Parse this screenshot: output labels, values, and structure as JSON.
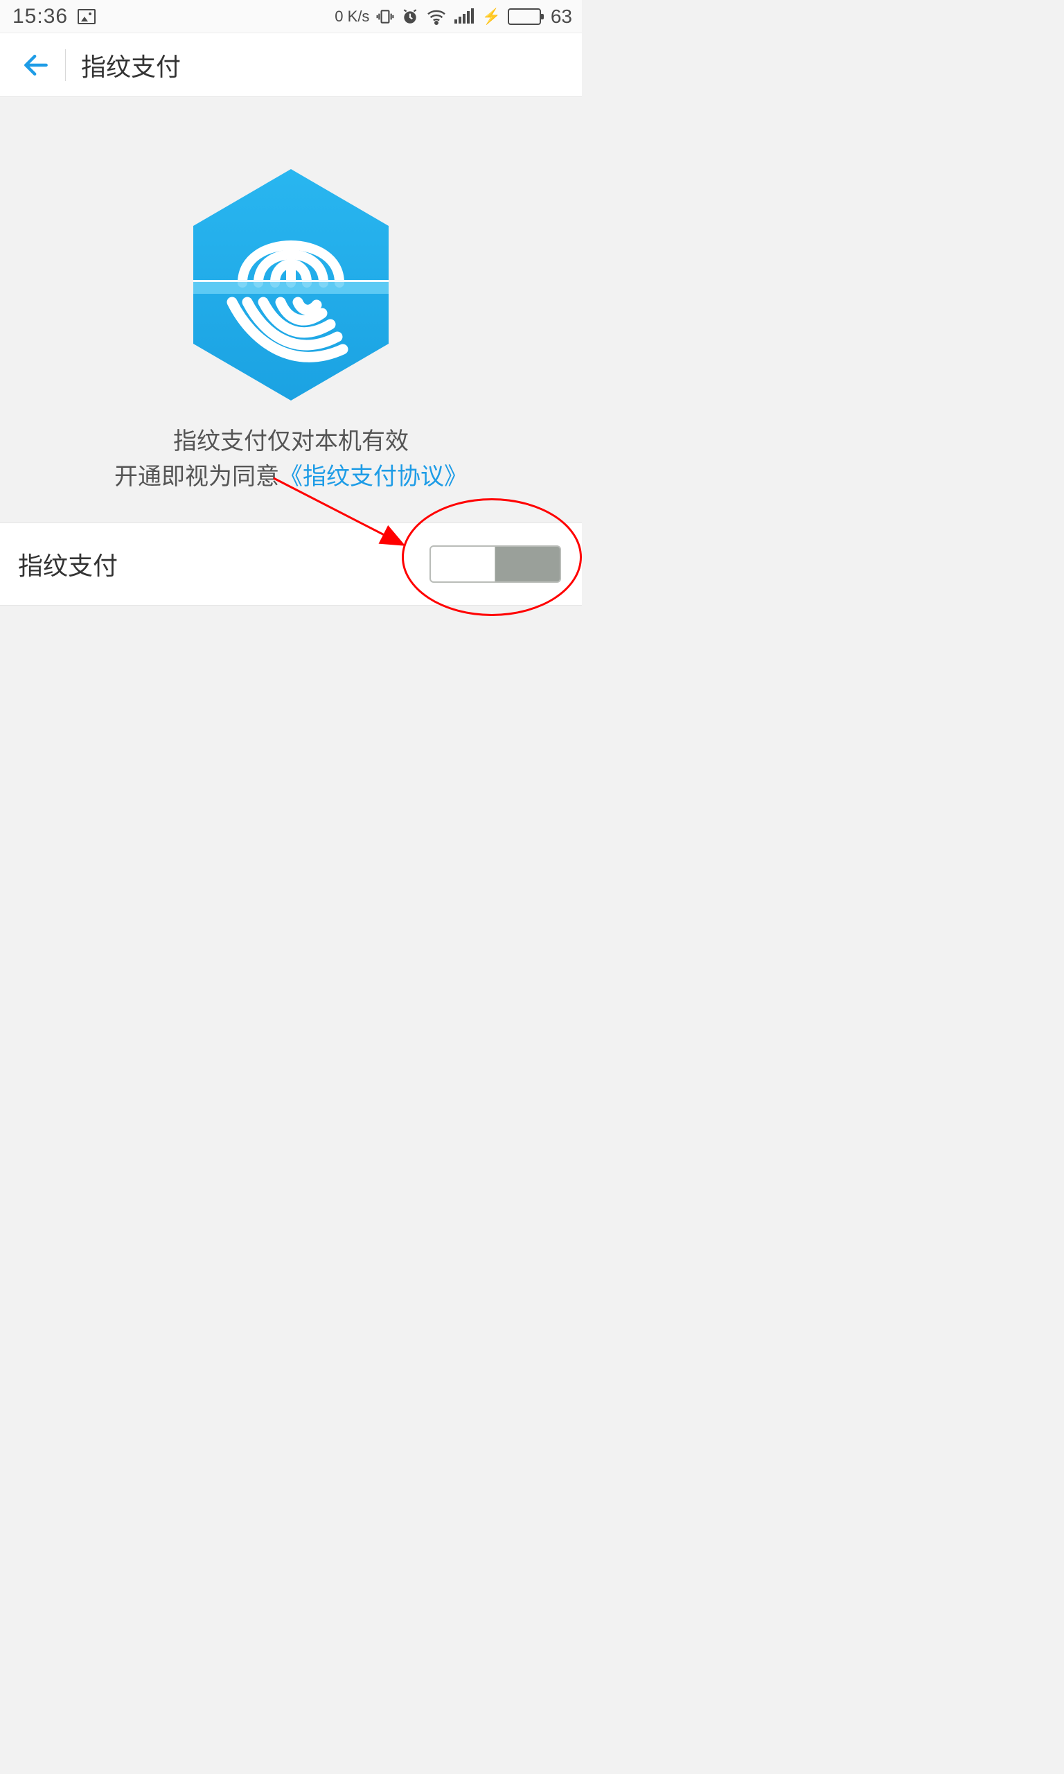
{
  "status_bar": {
    "time": "15:36",
    "network_speed": "0 K/s",
    "battery_percent": "63"
  },
  "header": {
    "title": "指纹支付"
  },
  "illustration": {
    "desc_line1": "指纹支付仅对本机有效",
    "desc_line2_prefix": "开通即视为同意",
    "agreement_link": "《指纹支付协议》"
  },
  "row": {
    "label": "指纹支付",
    "toggle_on": false
  },
  "colors": {
    "accent_blue": "#1e9ce6",
    "annotation_red": "#ff0000",
    "battery_green": "#3ecf1f"
  }
}
